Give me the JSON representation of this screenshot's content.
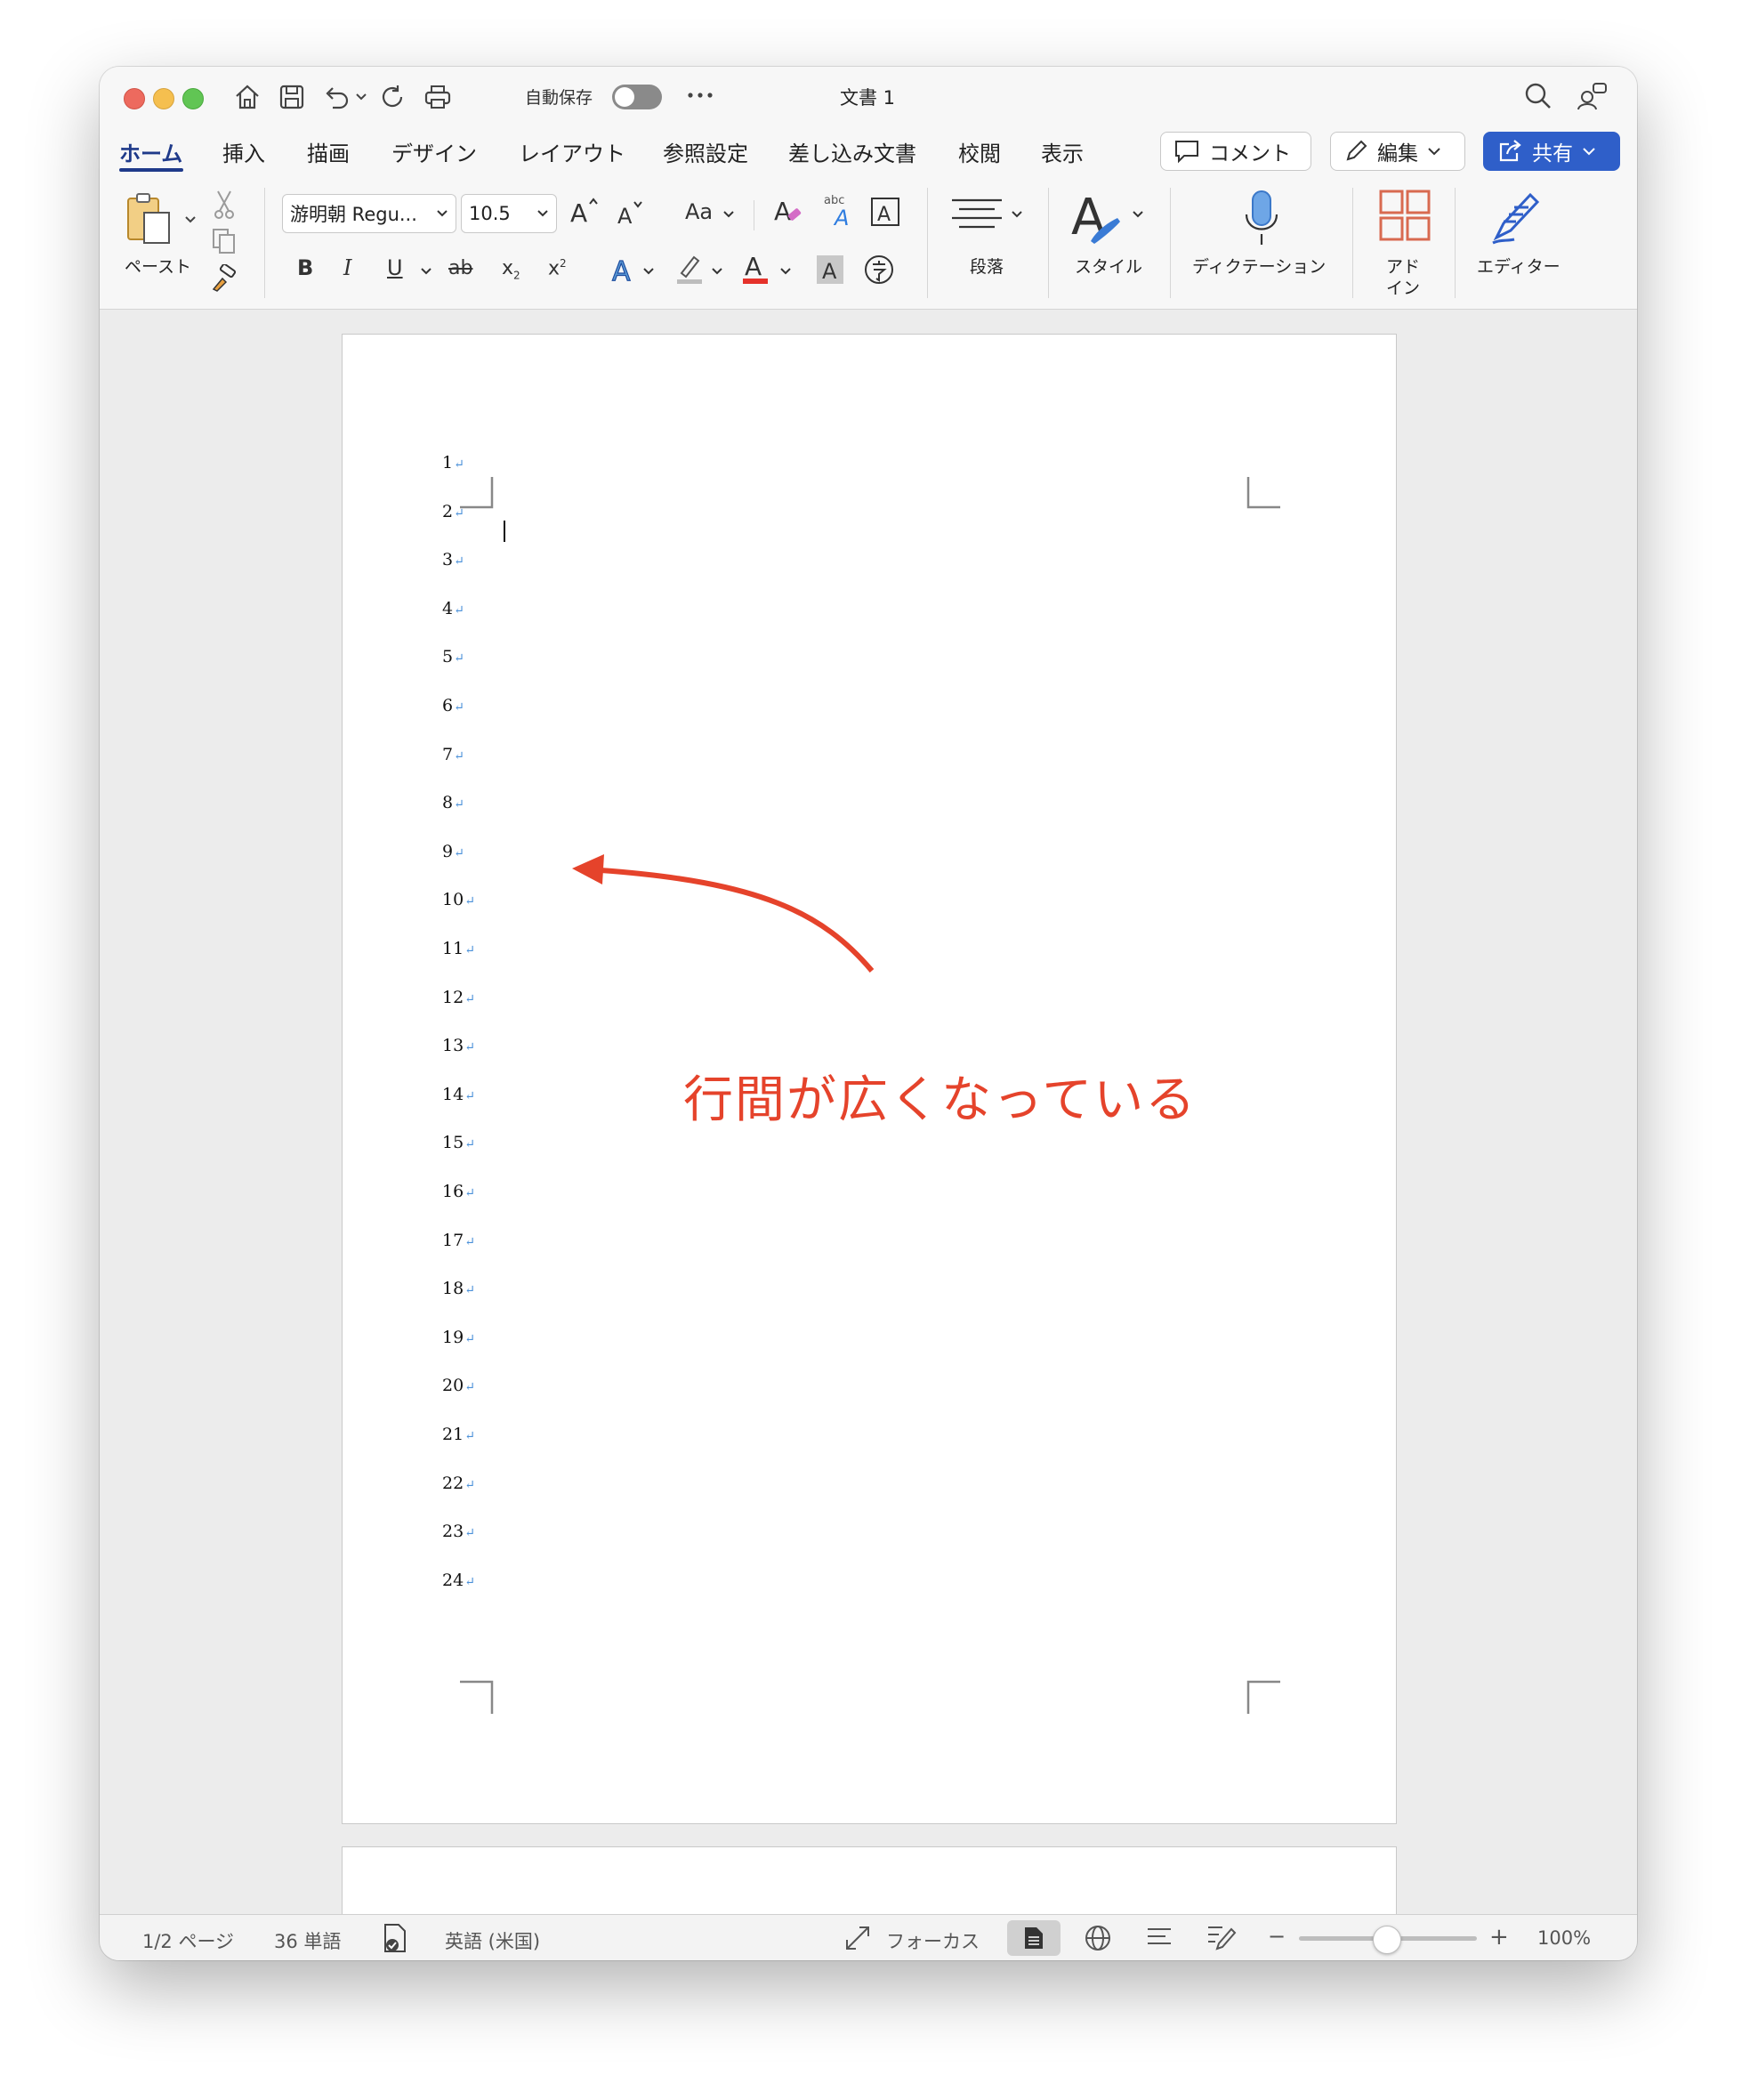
{
  "window": {
    "title": "文書 1"
  },
  "toolbar": {
    "autosave_label": "自動保存"
  },
  "tabs": [
    {
      "label": "ホーム"
    },
    {
      "label": "挿入"
    },
    {
      "label": "描画"
    },
    {
      "label": "デザイン"
    },
    {
      "label": "レイアウト"
    },
    {
      "label": "参照設定"
    },
    {
      "label": "差し込み文書"
    },
    {
      "label": "校閲"
    },
    {
      "label": "表示"
    }
  ],
  "actions": {
    "comment": "コメント",
    "edit": "編集",
    "share": "共有"
  },
  "ribbon": {
    "paste": "ペースト",
    "font_name": "游明朝 Regu...",
    "font_size": "10.5",
    "case_label": "Aa",
    "bold": "B",
    "italic": "I",
    "underline": "U",
    "strike": "ab",
    "subscript": "x",
    "superscript": "x",
    "paragraph": "段落",
    "styles": "スタイル",
    "dictation": "ディクテーション",
    "addins_line1": "アド",
    "addins_line2": "イン",
    "editor": "エディター"
  },
  "document": {
    "lines": [
      "1",
      "2",
      "3",
      "4",
      "5",
      "6",
      "7",
      "8",
      "9",
      "10",
      "11",
      "12",
      "13",
      "14",
      "15",
      "16",
      "17",
      "18",
      "19",
      "20",
      "21",
      "22",
      "23",
      "24"
    ],
    "paragraph_mark": "↵",
    "annotation": "行間が広くなっている"
  },
  "status": {
    "page": "1/2 ページ",
    "words": "36 単語",
    "language": "英語 (米国)",
    "focus": "フォーカス",
    "zoom": "100%",
    "zoom_minus": "−",
    "zoom_plus": "+"
  },
  "colors": {
    "accent": "#2f5fc9",
    "annotation": "#e5432b"
  }
}
